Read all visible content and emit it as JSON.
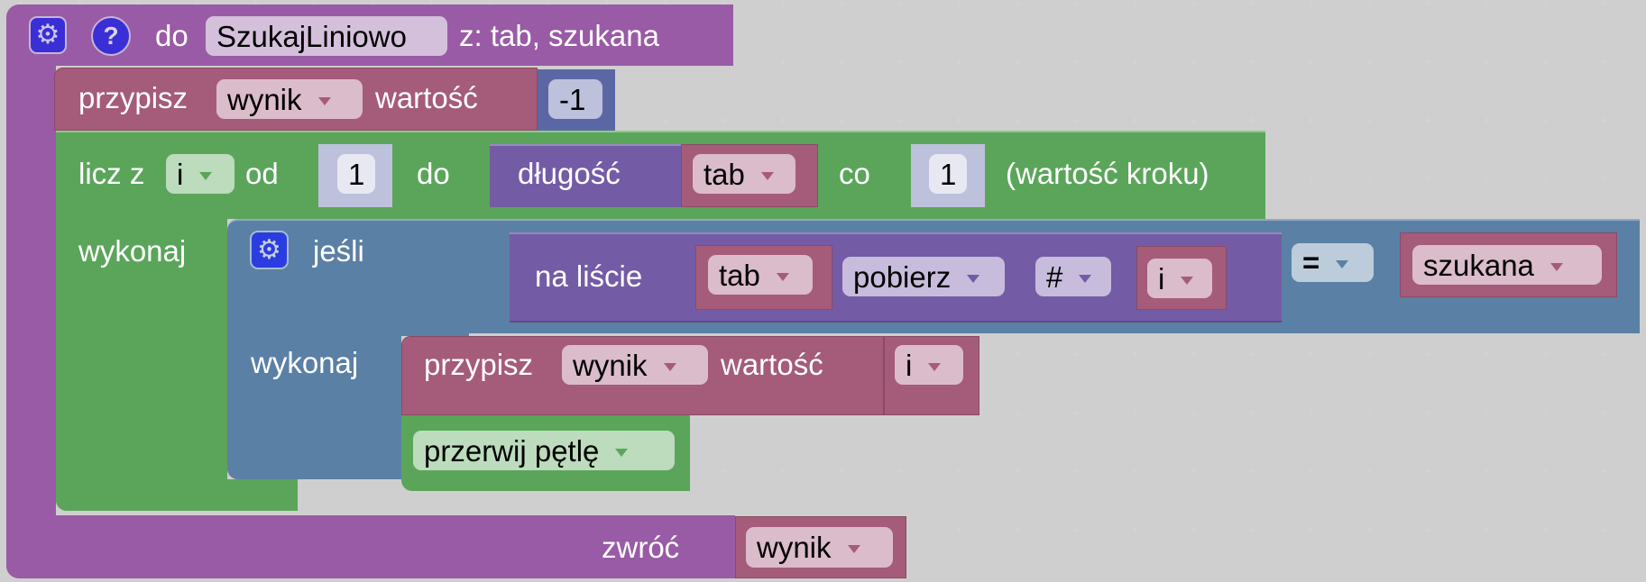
{
  "workspace": {
    "colors": {
      "procedure": "#995ba5",
      "variable": "#a55b7a",
      "math": "#5b67a5",
      "loop": "#5ba55b",
      "logic": "#5b80a5",
      "list": "#745ba5",
      "settings_icon": "#3a2fd6"
    }
  },
  "procedure": {
    "icons": [
      "gear-icon",
      "help-icon"
    ],
    "settings_icon_glyph": "⚙",
    "help_icon_glyph": "?",
    "keyword": "do",
    "name": "SzukajLiniowo",
    "params_label": "z: tab, szukana",
    "return_label": "zwróć",
    "return_variable": "wynik"
  },
  "set_initial": {
    "label": "przypisz",
    "variable": "wynik",
    "value_label": "wartość",
    "value": "-1"
  },
  "for_loop": {
    "label": "licz z",
    "variable": "i",
    "from_label": "od",
    "from_value": "1",
    "to_label": "do",
    "length_label": "długość",
    "length_variable": "tab",
    "step_label": "co",
    "step_value": "1",
    "step_hint": "(wartość kroku)",
    "do_label": "wykonaj"
  },
  "if_block": {
    "label": "jeśli",
    "do_label": "wykonaj",
    "condition": {
      "list_label": "na liście",
      "list_variable": "tab",
      "mode": "pobierz",
      "where": "#",
      "index_variable": "i",
      "operator": "=",
      "compare_variable": "szukana"
    },
    "then": {
      "set_label": "przypisz",
      "set_variable": "wynik",
      "value_label": "wartość",
      "value_variable": "i",
      "break_label": "przerwij pętlę"
    }
  }
}
